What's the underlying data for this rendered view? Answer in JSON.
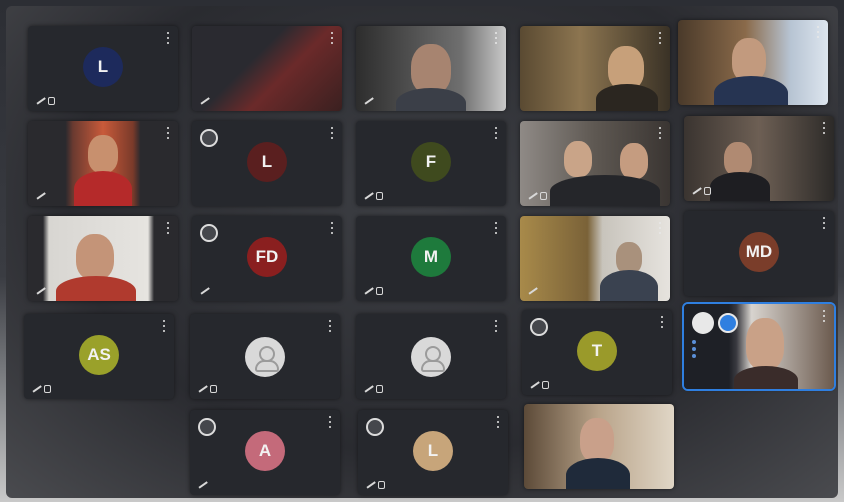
{
  "participants": [
    {
      "initials": "L",
      "avatar_color": "#1d2a5c"
    },
    {
      "initials": "L",
      "avatar_color": "#5a1f1f"
    },
    {
      "initials": "F",
      "avatar_color": "#3f4a1e"
    },
    {
      "initials": "FD",
      "avatar_color": "#8a1f1f"
    },
    {
      "initials": "M",
      "avatar_color": "#1e7a3c"
    },
    {
      "initials": "MD",
      "avatar_color": "#7a3d2a"
    },
    {
      "initials": "AS",
      "avatar_color": "#9aa12a"
    },
    {
      "initials": "T",
      "avatar_color": "#9a9a2a"
    },
    {
      "initials": "A",
      "avatar_color": "#c46a7a"
    },
    {
      "initials": "L",
      "avatar_color": "#c7a57a"
    }
  ],
  "icons": {
    "more": "more-vert-icon",
    "mic_off": "mic-off-icon",
    "camera_off": "camera-off-icon",
    "person": "person-icon",
    "presenting": "presenting-icon"
  },
  "colors": {
    "active_outline": "#2f7fe0",
    "tile_bg": "#26282d"
  }
}
